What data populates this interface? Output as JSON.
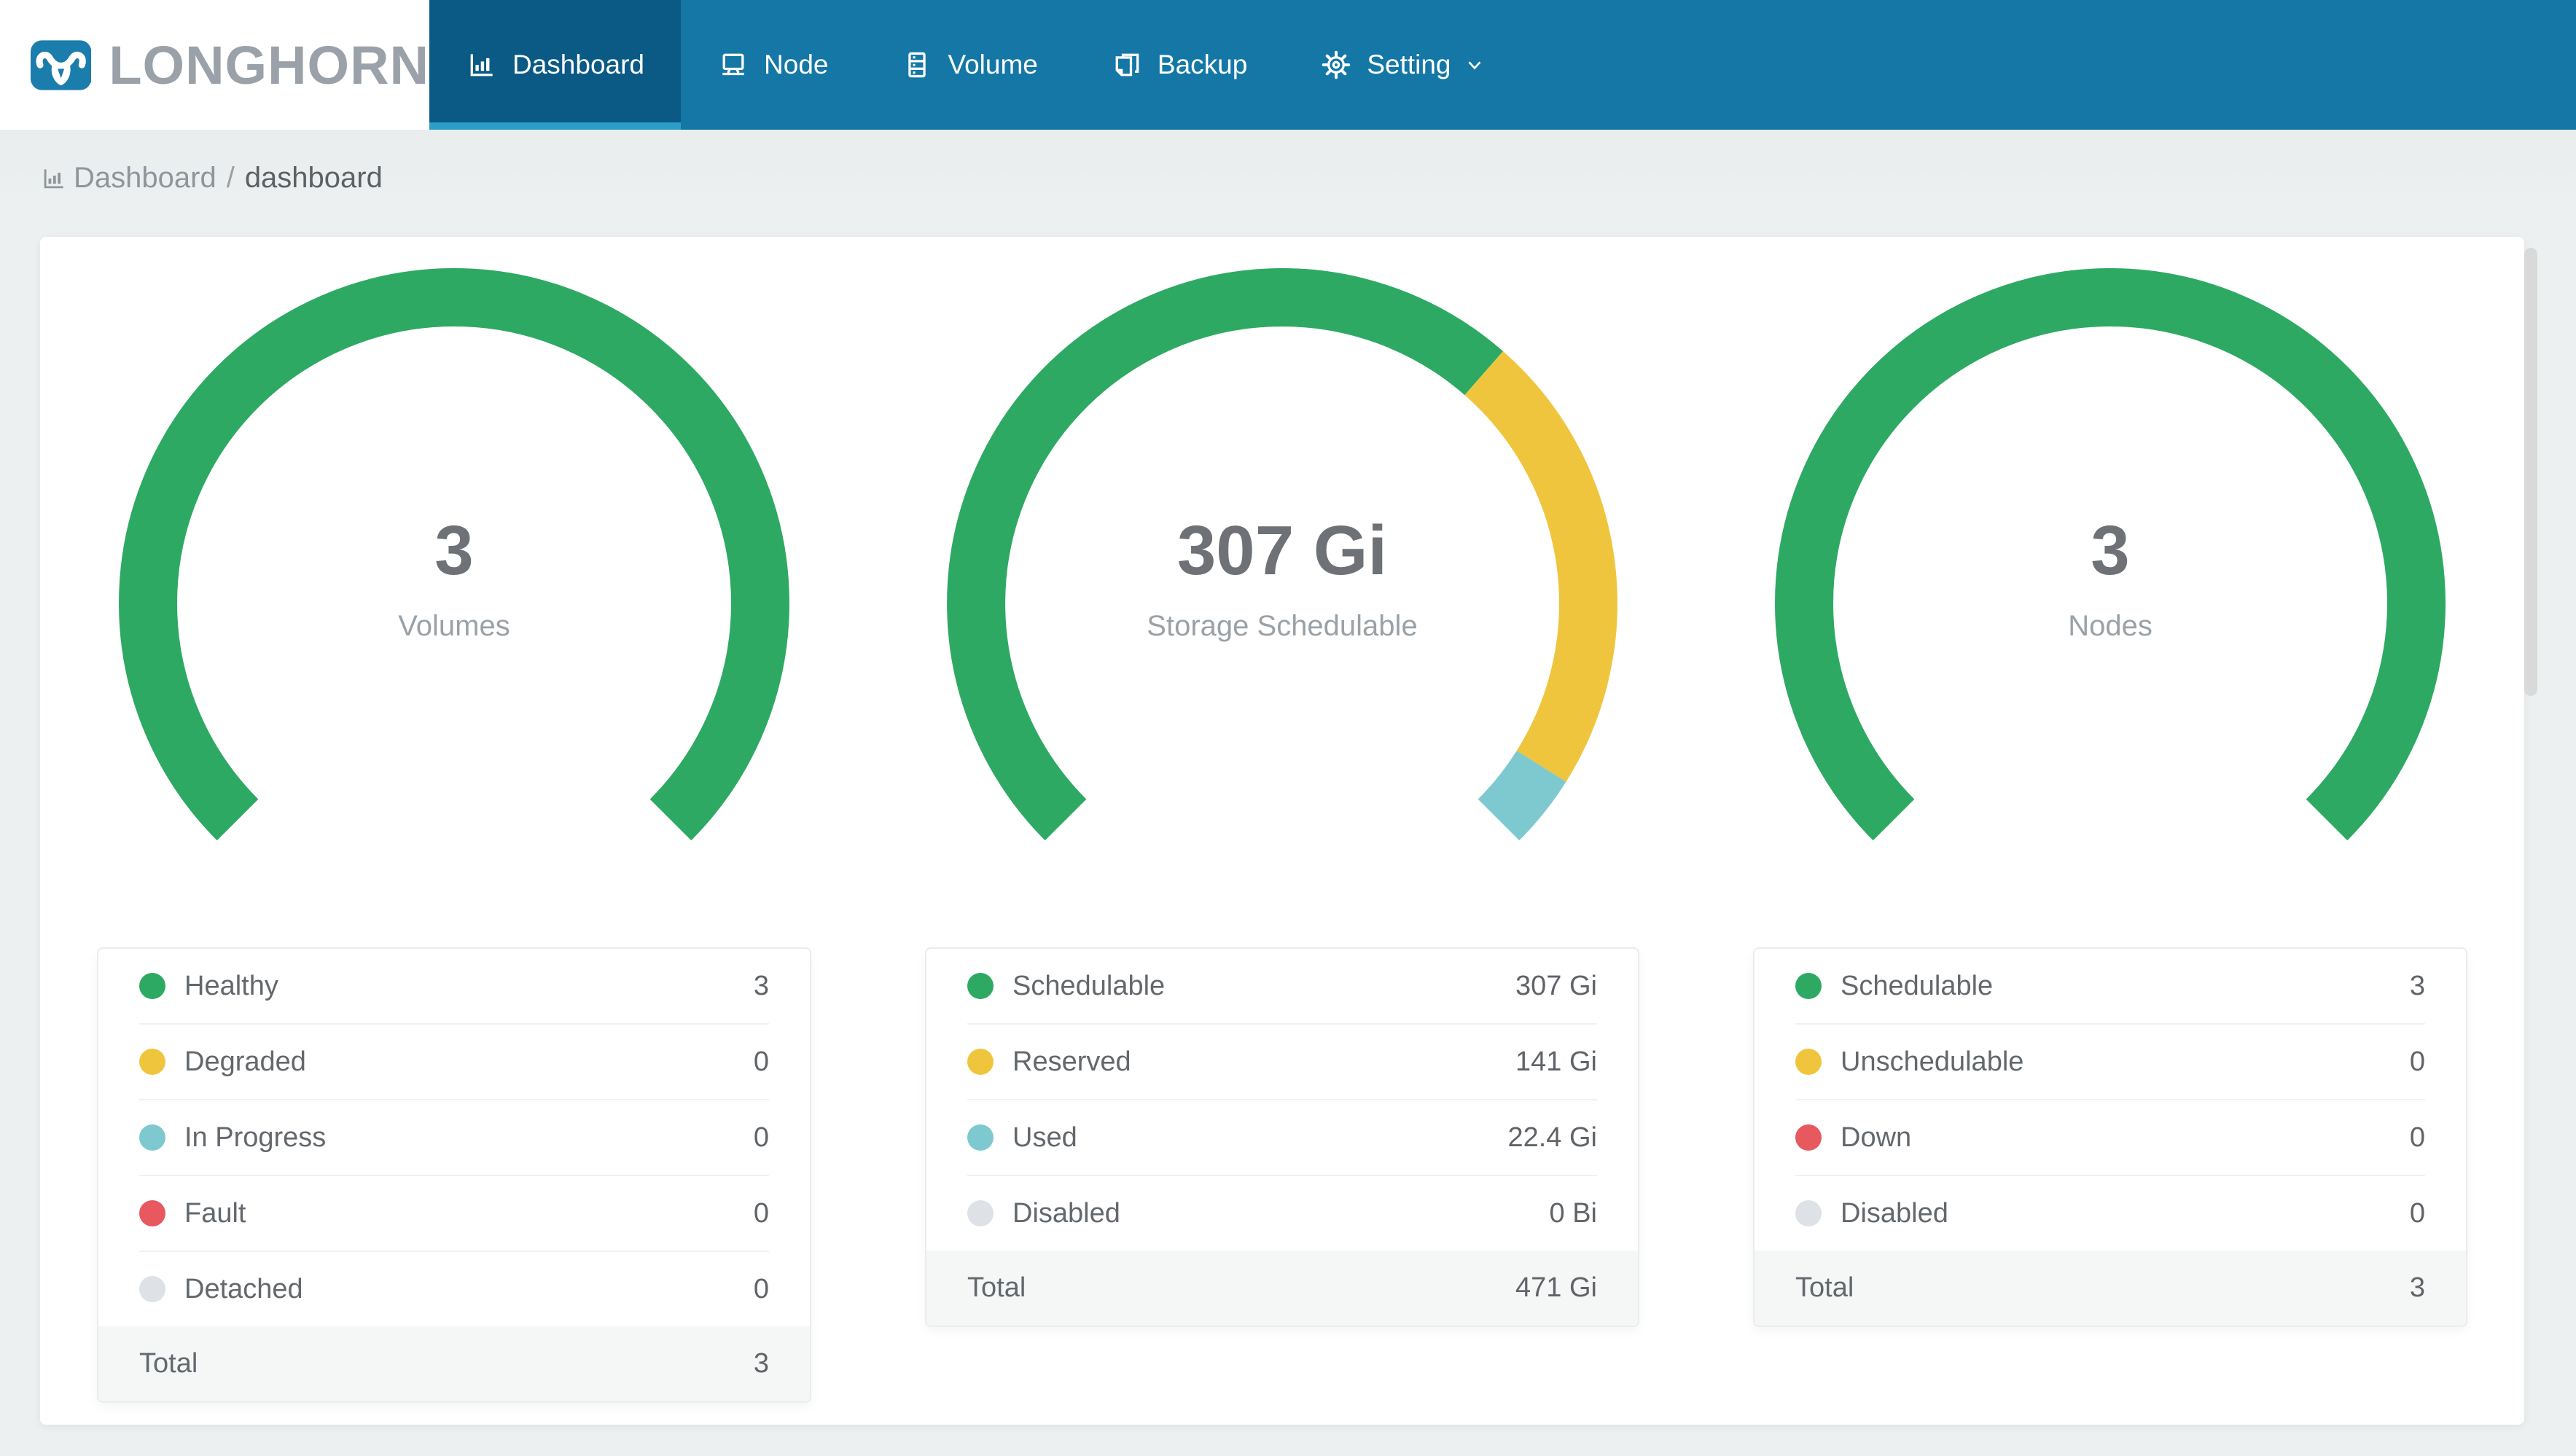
{
  "brand": {
    "name": "LONGHORN"
  },
  "nav": {
    "items": [
      {
        "id": "dashboard",
        "label": "Dashboard",
        "active": true
      },
      {
        "id": "node",
        "label": "Node",
        "active": false
      },
      {
        "id": "volume",
        "label": "Volume",
        "active": false
      },
      {
        "id": "backup",
        "label": "Backup",
        "active": false
      },
      {
        "id": "setting",
        "label": "Setting",
        "active": false,
        "has_dropdown": true
      }
    ]
  },
  "breadcrumb": {
    "root": "Dashboard",
    "separator": "/",
    "current": "dashboard"
  },
  "colors": {
    "navbar": "#1477A6",
    "navbar_active": "#0A5A85",
    "navbar_indicator": "#2C9EC7",
    "logo_blue": "#1B7DAB",
    "green": "#2EA963",
    "yellow": "#F0C53E",
    "teal": "#7EC9CF",
    "red": "#E8585F",
    "gray": "#DEE1E5",
    "page_bg": "#EDF0F0"
  },
  "chart_data": [
    {
      "type": "donut",
      "center_value": "3",
      "center_label": "Volumes",
      "start_deg": 135,
      "sweep_deg": 270,
      "segments": [
        {
          "label": "Healthy",
          "value": 3,
          "color": "#2EA963"
        },
        {
          "label": "Degraded",
          "value": 0,
          "color": "#F0C53E"
        },
        {
          "label": "In Progress",
          "value": 0,
          "color": "#7EC9CF"
        },
        {
          "label": "Fault",
          "value": 0,
          "color": "#E8585F"
        },
        {
          "label": "Detached",
          "value": 0,
          "color": "#DEE1E5"
        }
      ],
      "legend": [
        {
          "label": "Healthy",
          "value": "3",
          "color": "#2EA963"
        },
        {
          "label": "Degraded",
          "value": "0",
          "color": "#F0C53E"
        },
        {
          "label": "In Progress",
          "value": "0",
          "color": "#7EC9CF"
        },
        {
          "label": "Fault",
          "value": "0",
          "color": "#E8585F"
        },
        {
          "label": "Detached",
          "value": "0",
          "color": "#DEE1E5"
        }
      ],
      "total": {
        "label": "Total",
        "value": "3"
      }
    },
    {
      "type": "donut",
      "center_value": "307 Gi",
      "center_label": "Storage Schedulable",
      "start_deg": 135,
      "sweep_deg": 270,
      "unit": "Gi",
      "segments": [
        {
          "label": "Schedulable",
          "value": 307,
          "color": "#2EA963"
        },
        {
          "label": "Reserved",
          "value": 141,
          "color": "#F0C53E"
        },
        {
          "label": "Used",
          "value": 22.4,
          "color": "#7EC9CF"
        },
        {
          "label": "Disabled",
          "value": 0,
          "color": "#DEE1E5"
        }
      ],
      "legend": [
        {
          "label": "Schedulable",
          "value": "307 Gi",
          "color": "#2EA963"
        },
        {
          "label": "Reserved",
          "value": "141 Gi",
          "color": "#F0C53E"
        },
        {
          "label": "Used",
          "value": "22.4 Gi",
          "color": "#7EC9CF"
        },
        {
          "label": "Disabled",
          "value": "0 Bi",
          "color": "#DEE1E5"
        }
      ],
      "total": {
        "label": "Total",
        "value": "471 Gi"
      }
    },
    {
      "type": "donut",
      "center_value": "3",
      "center_label": "Nodes",
      "start_deg": 135,
      "sweep_deg": 270,
      "segments": [
        {
          "label": "Schedulable",
          "value": 3,
          "color": "#2EA963"
        },
        {
          "label": "Unschedulable",
          "value": 0,
          "color": "#F0C53E"
        },
        {
          "label": "Down",
          "value": 0,
          "color": "#E8585F"
        },
        {
          "label": "Disabled",
          "value": 0,
          "color": "#DEE1E5"
        }
      ],
      "legend": [
        {
          "label": "Schedulable",
          "value": "3",
          "color": "#2EA963"
        },
        {
          "label": "Unschedulable",
          "value": "0",
          "color": "#F0C53E"
        },
        {
          "label": "Down",
          "value": "0",
          "color": "#E8585F"
        },
        {
          "label": "Disabled",
          "value": "0",
          "color": "#DEE1E5"
        }
      ],
      "total": {
        "label": "Total",
        "value": "3"
      }
    }
  ]
}
